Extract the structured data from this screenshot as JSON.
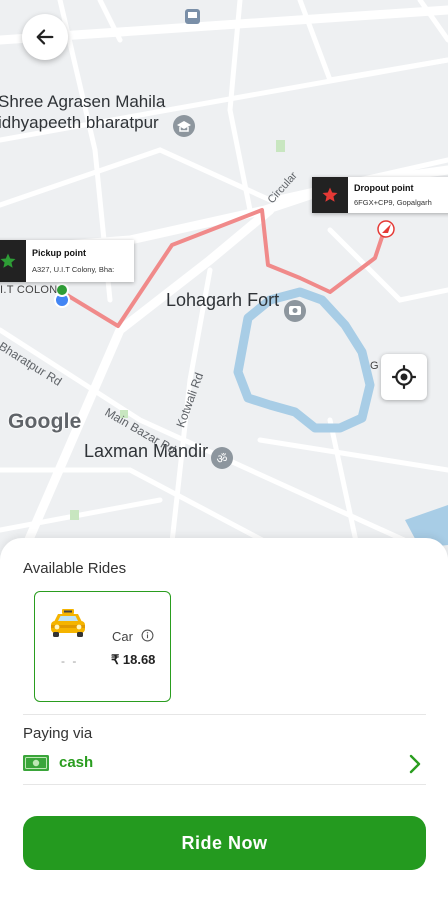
{
  "map": {
    "places": {
      "school": "Shree Agrasen Mahila\nidhyapeeth bharatpur",
      "fort": "Lohagarh Fort",
      "temple": "Laxman Mandir",
      "uit": "I.T COLON",
      "grh": "G    RH"
    },
    "roads": {
      "bharatpur": "Bharatpur Rd",
      "main_bazar": "Main Bazar Rd",
      "kotwali": "Kotwali Rd",
      "circular": "Circular"
    },
    "attribution": "Google",
    "pickup": {
      "title": "Pickup point",
      "address": "A327, U.I.T Colony, Bha:"
    },
    "dropoff": {
      "title": "Dropout point",
      "address": "6FGX+CP9, Gopalgarh"
    },
    "route_color": "#f08a8a",
    "moat_color": "#a8cde6"
  },
  "icons": {
    "back": "arrow-left-icon",
    "locate": "my-location-icon",
    "car": "taxi-car-icon",
    "info": "info-icon",
    "cash": "cash-icon",
    "chevron": "chevron-right-icon"
  },
  "rides": {
    "title": "Available Rides",
    "items": [
      {
        "name": "Car",
        "eta": "- -",
        "price": "₹ 18.68",
        "selected": true
      }
    ]
  },
  "payment": {
    "label": "Paying via",
    "method": "cash"
  },
  "cta": {
    "label": "Ride Now",
    "color": "#249a1f"
  }
}
